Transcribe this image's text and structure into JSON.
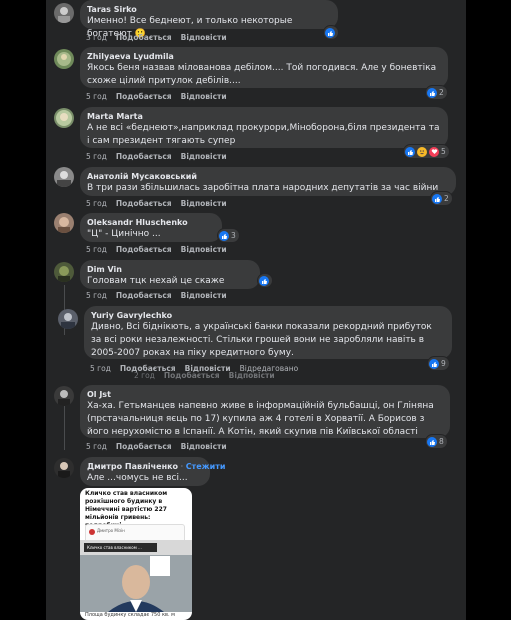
{
  "comments": [
    {
      "name": "Taras Sirko",
      "text": "Именно! Все беднеют, и только некоторые богатеют 🙂",
      "time": "3 год",
      "like": "Подобається",
      "reply": "Відповісти",
      "reactions": "",
      "avatar_color": "#6b6b6b"
    },
    {
      "name": "Zhilyaeva Lyudmila",
      "text": "Якось беня назвав мілованова дебілом.... Той погодився. Але у боневтіка схоже цілий притулок дебілів....",
      "time": "5 год",
      "like": "Подобається",
      "reply": "Відповісти",
      "reactions": "2",
      "avatar_color": "#6f8a5a"
    },
    {
      "name": "Marta Marta",
      "text": "А не всі «беднеют»,наприклад прокурори,Міноборона,біля президента та і сам президент тягають супер",
      "time": "5 год",
      "like": "Подобається",
      "reply": "Відповісти",
      "reactions": "5",
      "avatar_color": "#7a8f6a"
    },
    {
      "name": "Анатолій Мусаковський",
      "text": "В три рази збільшилась заробітна плата народних депутатів за час війни",
      "time": "5 год",
      "like": "Подобається",
      "reply": "Відповісти",
      "reactions": "2",
      "avatar_color": "#8a8a8a"
    },
    {
      "name": "Oleksandr Hluschenko",
      "text": "\"Ц\" - Цинічно ...",
      "time": "5 год",
      "like": "Подобається",
      "reply": "Відповісти",
      "reactions": "3",
      "avatar_color": "#9a8070"
    },
    {
      "name": "Dim Vin",
      "text": "Головам тцк нехай це скаже",
      "time": "5 год",
      "like": "Подобається",
      "reply": "Відповісти",
      "reactions": "",
      "avatar_color": "#4e5a3a"
    },
    {
      "name": "Yuriy Gavrylechko",
      "text": "Дивно, Всі біднікють, а українські банки показали рекордний прибуток за всі роки незалежності. Стільки грошей вони не заробляли навіть в 2005-2007 роках на піку кредитного буму.",
      "time": "5 год",
      "like": "Подобається",
      "reply": "Відповісти",
      "edited": "Відредаговано",
      "reactions": "9",
      "avatar_color": "#5a5f6a"
    },
    {
      "name": "Ol Jst",
      "text": "Ха-ха. Гетьманцев напевно живе в інформаційній бульбашці, он Гліняна (прстачальниця яєць по 17) купила аж 4 готелі в Хорватії. А Борисов з його нерухомістю в Іспанії. А Котін, який скупив пів Київської області",
      "time": "5 год",
      "like": "Подобається",
      "reply": "Відповісти",
      "reactions": "8",
      "avatar_color": "#3a3a3a"
    },
    {
      "name": "Дмитро Павліченко",
      "follow": "Стежити",
      "text": "Але ...чомусь не всі...",
      "avatar_color": "#2e2e2e"
    }
  ],
  "ghost_actions": {
    "time": "2 год",
    "like": "Подобається",
    "reply": "Відповісти"
  },
  "shared_post": {
    "headline": "Кличко став власником розкішного будинку в Німеччині вартістю 227 мільйонів гривень: подробиці",
    "author": "Дмитро Мізін",
    "small_title": "Кличко став власником ...",
    "caption": "Площа будинку складає 750 кв. м"
  },
  "dot_sep": "·"
}
